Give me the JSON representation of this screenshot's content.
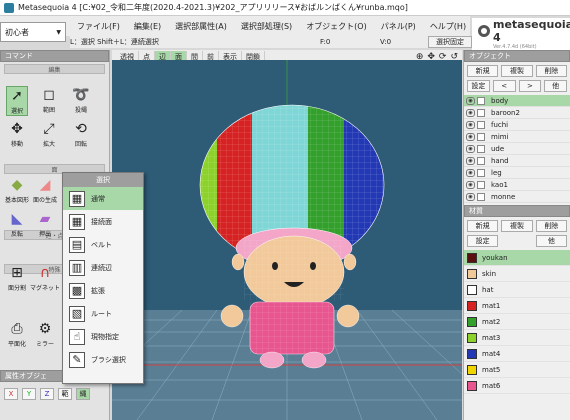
{
  "window": {
    "title": "Metasequoia 4 [C:¥02_令和二年度(2020.4-2021.3)¥202_アプリリリース¥おばルンばくん¥runba.mqo]"
  },
  "menu": [
    "ファイル(F)",
    "編集(E)",
    "選択部属性(A)",
    "選択部処理(S)",
    "オブジェクト(O)",
    "パネル(P)",
    "ヘルプ(H)"
  ],
  "mode": {
    "label": "初心者"
  },
  "hint": {
    "text": "L：選択  Shift＋L：連続選択",
    "f": "F:0",
    "v": "V:0",
    "fix": "選択固定"
  },
  "logo": {
    "name": "metasequoia 4",
    "version": "Ver.4.7.4d (64bit)"
  },
  "command": {
    "title": "コマンド",
    "sections": {
      "edit": "編集",
      "face": "面",
      "edge": "辺・点",
      "special": "特殊"
    },
    "tools": {
      "select": "選択",
      "range": "範囲",
      "lasso": "投縄",
      "move": "移動",
      "scale": "拡大",
      "rotate": "回転",
      "basic": "基本図形",
      "face_gen": "面の生成",
      "flip": "反転",
      "extrude": "押出",
      "knife": "面分割",
      "magnet": "マグネット",
      "flatten": "平面化",
      "symmetry": "ミラー"
    },
    "fn_title": "属性オブジェ",
    "axes": [
      "X",
      "Y",
      "Z"
    ],
    "extra": [
      "範",
      "縄"
    ]
  },
  "popup": {
    "title": "選択",
    "items": [
      "通常",
      "接続面",
      "ベルト",
      "連続辺",
      "拡張",
      "ルート",
      "現物指定",
      "ブラシ選択"
    ]
  },
  "viewtool": {
    "buttons": [
      "透視",
      "点",
      "辺",
      "面",
      "間",
      "前",
      "表示",
      "閉鎖"
    ],
    "on": [
      "辺",
      "面"
    ]
  },
  "object_panel": {
    "title": "オブジェクト",
    "buttons": [
      "新規",
      "複製",
      "削除"
    ],
    "row2": [
      "設定",
      "<",
      ">",
      "他"
    ],
    "items": [
      "body",
      "baroon2",
      "fuchi",
      "mimi",
      "ude",
      "hand",
      "leg",
      "kao1",
      "monne"
    ]
  },
  "material_panel": {
    "title": "材質",
    "buttons": [
      "新規",
      "複製",
      "削除"
    ],
    "row2": [
      "設定",
      "他"
    ],
    "items": [
      {
        "name": "youkan",
        "color": "#5a1010"
      },
      {
        "name": "skin",
        "color": "#f2c99a"
      },
      {
        "name": "hat",
        "color": "#ffffff"
      },
      {
        "name": "mat1",
        "color": "#d62222"
      },
      {
        "name": "mat2",
        "color": "#33a02c"
      },
      {
        "name": "mat3",
        "color": "#8cd22a"
      },
      {
        "name": "mat4",
        "color": "#2338b5"
      },
      {
        "name": "mat5",
        "color": "#f0d600"
      },
      {
        "name": "mat6",
        "color": "#e8568f"
      }
    ]
  },
  "colors": {
    "accent": "#a8d7a8",
    "viewport_bg": "#2e5b75"
  }
}
